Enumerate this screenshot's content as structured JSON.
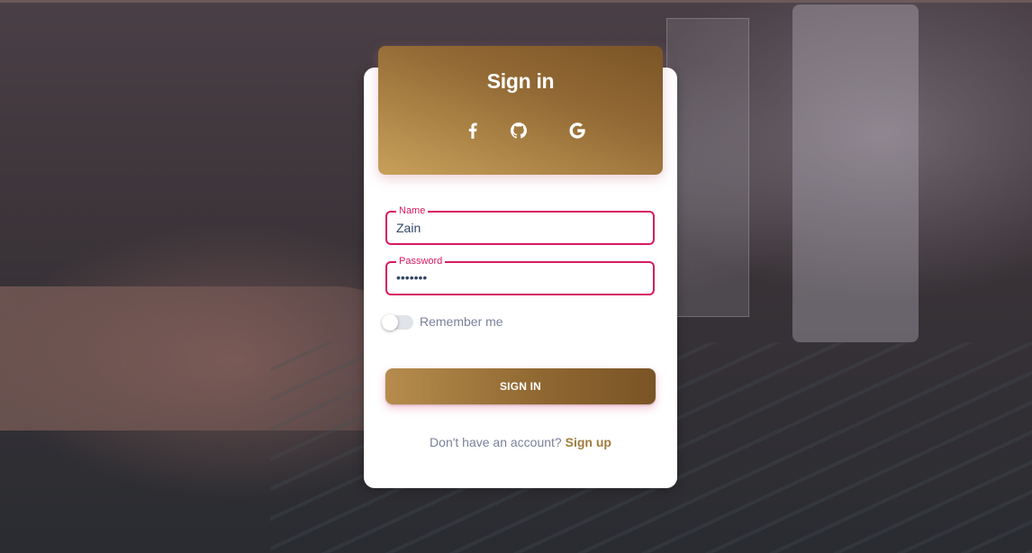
{
  "header": {
    "title": "Sign in",
    "social": [
      {
        "icon": "facebook-icon"
      },
      {
        "icon": "github-icon"
      },
      {
        "icon": "google-icon"
      }
    ]
  },
  "form": {
    "name": {
      "label": "Name",
      "value": "Zain"
    },
    "password": {
      "label": "Password",
      "value": "•••••••"
    },
    "remember": {
      "label": "Remember me",
      "checked": false
    },
    "submit_label": "SIGN IN"
  },
  "footer": {
    "prompt": "Don't have an account?",
    "link": "Sign up"
  },
  "colors": {
    "accent": "#d81b60",
    "brand_gold": "#a07c3d",
    "text_muted": "#7b809a"
  }
}
